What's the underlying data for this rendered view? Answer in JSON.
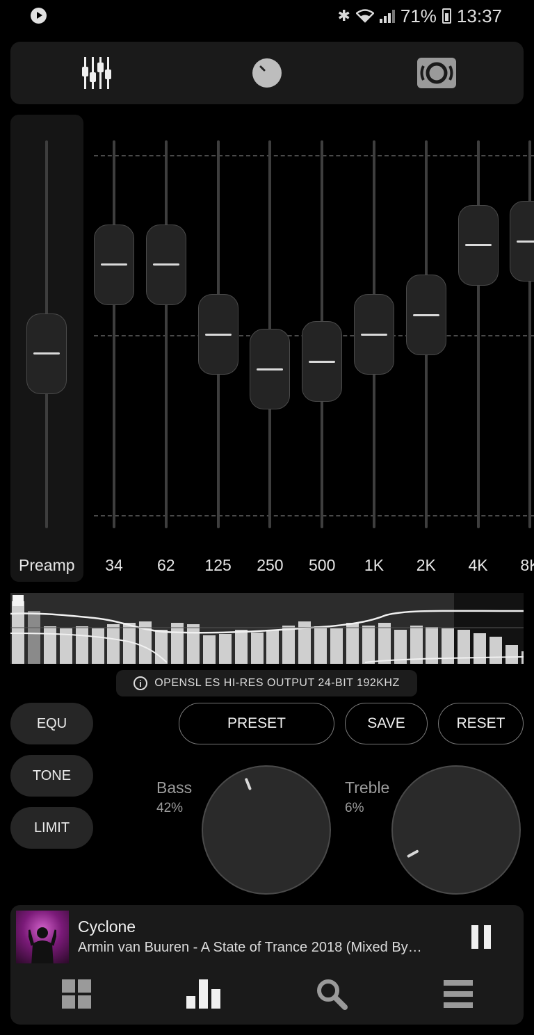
{
  "status_bar": {
    "battery": "71%",
    "time": "13:37",
    "icons": [
      "play-icon",
      "bluetooth-icon",
      "wifi-icon",
      "signal-icon",
      "battery-icon"
    ]
  },
  "top_tabs": [
    {
      "name": "equalizer-tab",
      "icon": "sliders-icon"
    },
    {
      "name": "tone-tab",
      "icon": "knob-icon"
    },
    {
      "name": "speaker-tab",
      "icon": "speaker-icon"
    }
  ],
  "equalizer": {
    "preamp": {
      "label": "Preamp",
      "level": 0.55
    },
    "bands": [
      {
        "label": "34",
        "level": 0.32
      },
      {
        "label": "62",
        "level": 0.32
      },
      {
        "label": "125",
        "level": 0.5
      },
      {
        "label": "250",
        "level": 0.59
      },
      {
        "label": "500",
        "level": 0.57
      },
      {
        "label": "1K",
        "level": 0.5
      },
      {
        "label": "2K",
        "level": 0.45
      },
      {
        "label": "4K",
        "level": 0.27
      },
      {
        "label": "8K",
        "level": 0.26
      }
    ]
  },
  "spectrum": {
    "levels": [
      0.92,
      0.78,
      0.55,
      0.52,
      0.55,
      0.52,
      0.58,
      0.6,
      0.62,
      0.5,
      0.6,
      0.58,
      0.42,
      0.44,
      0.5,
      0.46,
      0.5,
      0.56,
      0.62,
      0.55,
      0.52,
      0.6,
      0.56,
      0.6,
      0.5,
      0.56,
      0.54,
      0.52,
      0.5,
      0.45,
      0.4,
      0.28,
      0.18
    ]
  },
  "output_info": {
    "text": "OPENSL ES HI-RES OUTPUT 24-BIT 192KHZ",
    "icon": "info-icon"
  },
  "modes": {
    "equ": "EQU",
    "tone": "TONE",
    "limit": "LIMIT"
  },
  "actions": {
    "preset": "PRESET",
    "save": "SAVE",
    "reset": "RESET"
  },
  "knobs": {
    "bass": {
      "label": "Bass",
      "value": "42%",
      "level": 0.42
    },
    "treble": {
      "label": "Treble",
      "value": "6%",
      "level": 0.06
    }
  },
  "player": {
    "title": "Cyclone",
    "artist": "Armin van Buuren - A State of Trance 2018 (Mixed By…",
    "pause_icon": "pause-icon"
  },
  "bottom_nav": [
    {
      "name": "library-nav",
      "icon": "grid-icon"
    },
    {
      "name": "equalizer-nav",
      "icon": "bar-chart-icon"
    },
    {
      "name": "search-nav",
      "icon": "search-icon"
    },
    {
      "name": "menu-nav",
      "icon": "hamburger-icon"
    }
  ]
}
